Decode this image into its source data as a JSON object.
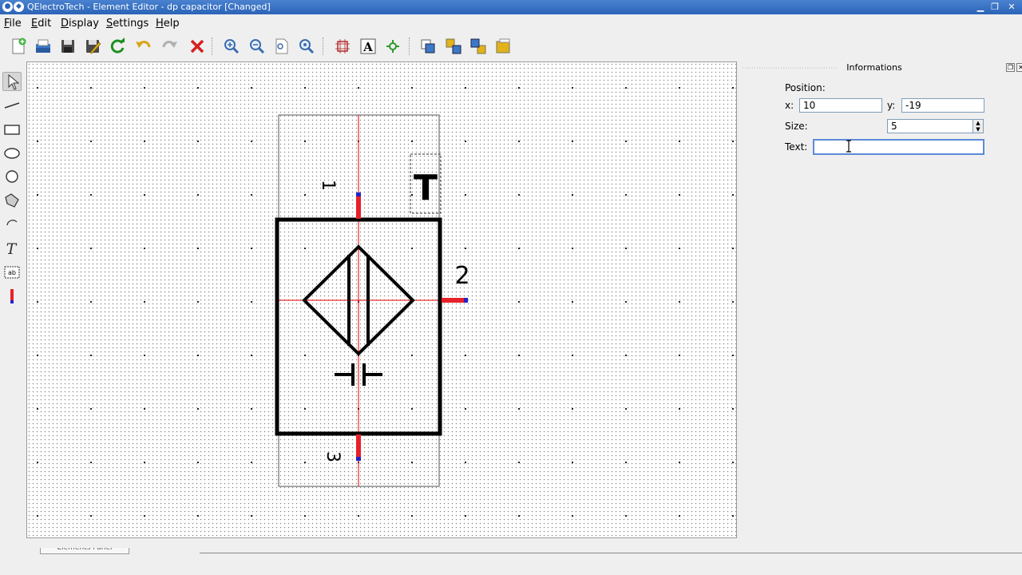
{
  "window": {
    "title": "QElectroTech - Element Editor - dp capacitor [Changed]",
    "app_icon": "qet-icon"
  },
  "menu": {
    "items": [
      {
        "mnemonic": "F",
        "rest": "ile"
      },
      {
        "mnemonic": "E",
        "rest": "dit"
      },
      {
        "mnemonic": "D",
        "rest": "isplay"
      },
      {
        "mnemonic": "S",
        "rest": "ettings"
      },
      {
        "mnemonic": "H",
        "rest": "elp"
      }
    ]
  },
  "toolbar": {
    "icons": [
      "new-icon",
      "open-icon",
      "save-icon",
      "save-as-icon",
      "reload-icon",
      "undo-icon",
      "redo-icon",
      "delete-icon",
      "zoom-in-icon",
      "zoom-out-icon",
      "zoom-fit-icon",
      "zoom-reset-icon",
      "edit-size-icon",
      "edit-names-icon",
      "edit-author-icon",
      "bring-forward-icon",
      "raise-icon",
      "lower-icon",
      "send-backward-icon"
    ]
  },
  "tools": {
    "icons": [
      "select-icon",
      "line-icon",
      "rectangle-icon",
      "ellipse-icon",
      "circle-icon",
      "polygon-icon",
      "arc-icon",
      "text-icon",
      "textfield-icon",
      "terminal-icon"
    ]
  },
  "drawing": {
    "terminal_labels": [
      "1",
      "2",
      "3"
    ],
    "text_item": "T",
    "colors": {
      "terminal": "#e8202a",
      "terminal_tip": "#2323c8",
      "axis": "#e60000",
      "stroke": "#000000"
    }
  },
  "info_panel": {
    "title": "Informations",
    "position_label": "Position:",
    "x_label": "x:",
    "x_value": "10",
    "y_label": "y:",
    "y_value": "-19",
    "size_label": "Size:",
    "size_value": "5",
    "text_label": "Text:",
    "text_value": ""
  },
  "bottom": {
    "tab_label": "Elements Panel"
  }
}
